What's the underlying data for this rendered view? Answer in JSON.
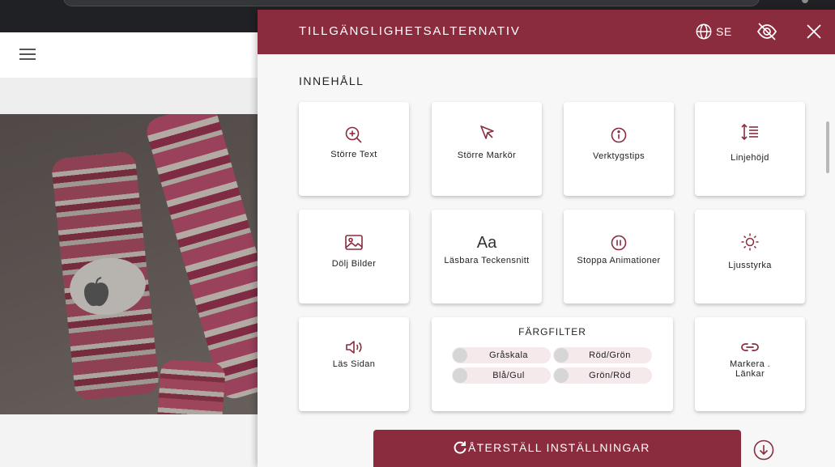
{
  "colors": {
    "accent": "#8a2b3e",
    "chip_bg": "#f5e9ec",
    "panel_bg": "#f7f7f7"
  },
  "panel": {
    "title": "TILLGÄNGLIGHETSALTERNATIV",
    "language_label": "SE",
    "language_icon": "globe-icon",
    "hide_icon": "eye-off-icon",
    "close_icon": "close-icon",
    "section_label": "INNEHÅLL",
    "tiles": [
      {
        "label": "Större Text",
        "icon": "zoom-in-icon"
      },
      {
        "label": "Större Markör",
        "icon": "cursor-icon"
      },
      {
        "label": "Verktygstips",
        "icon": "info-icon"
      },
      {
        "label": "Linjehöjd",
        "icon": "line-height-icon"
      },
      {
        "label": "Dölj Bilder",
        "icon": "image-icon"
      },
      {
        "label": "Läsbara Teckensnitt",
        "icon": "font-icon",
        "glyph": "Aa"
      },
      {
        "label": "Stoppa Animationer",
        "icon": "pause-icon"
      },
      {
        "label": "Ljusstyrka",
        "icon": "sun-icon"
      },
      {
        "label": "Läs Sidan",
        "icon": "speaker-icon"
      },
      {
        "label": "Markera  .\nLänkar",
        "icon": "link-icon"
      }
    ],
    "color_filter": {
      "title": "FÄRGFILTER",
      "options": [
        "Gråskala",
        "Röd/Grön",
        "Blå/Gul",
        "Grön/Röd"
      ]
    },
    "reset_label": "ÅTERSTÄLL INSTÄLLNINGAR",
    "reset_icon": "refresh-icon",
    "scroll_down_icon": "arrow-down-circle-icon"
  },
  "site": {
    "menu_icon": "hamburger-icon",
    "logo_icon": "apple-icon"
  }
}
